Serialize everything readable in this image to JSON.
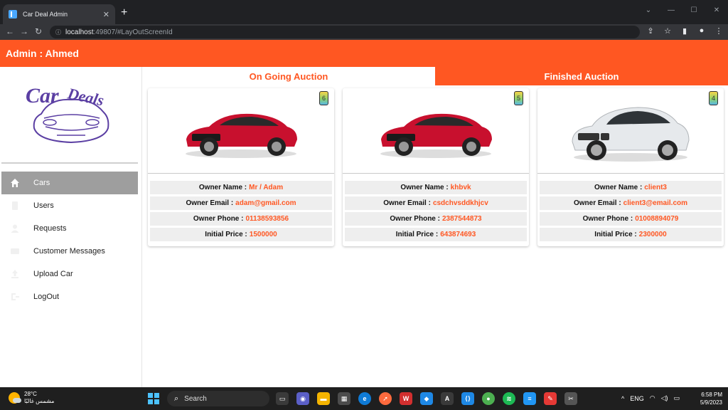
{
  "browser": {
    "tab_title": "Car Deal Admin",
    "url_host": "localhost",
    "url_rest": ":49807/#LayOutScreenId"
  },
  "app": {
    "title": "Admin : Ahmed",
    "logo_text": "CarDeals",
    "accent_color": "#ff5722"
  },
  "sidebar": {
    "items": [
      {
        "label": "Cars",
        "icon": "home-icon",
        "active": true
      },
      {
        "label": "Users",
        "icon": "user-list-icon",
        "active": false
      },
      {
        "label": "Requests",
        "icon": "person-icon",
        "active": false
      },
      {
        "label": "Customer Messages",
        "icon": "message-icon",
        "active": false
      },
      {
        "label": "Upload Car",
        "icon": "upload-icon",
        "active": false
      },
      {
        "label": "LogOut",
        "icon": "logout-icon",
        "active": false
      }
    ]
  },
  "tabs": [
    {
      "label": "On Going Auction",
      "selected": true
    },
    {
      "label": "Finished Auction",
      "selected": false
    }
  ],
  "cars": [
    {
      "badge": "6",
      "car_color": "#c8102e",
      "labels": {
        "name": "Owner Name :",
        "email": "Owner Email :",
        "phone": "Owner Phone :",
        "price": "Initial Price :"
      },
      "owner_name": "Mr / Adam",
      "owner_email": "adam@gmail.com",
      "owner_phone": "01138593856",
      "initial_price": "1500000"
    },
    {
      "badge": "5",
      "car_color": "#c8102e",
      "labels": {
        "name": "Owner Name :",
        "email": "Owner Email :",
        "phone": "Owner Phone :",
        "price": "Initial Price :"
      },
      "owner_name": "khbvk",
      "owner_email": "csdchvsddkhjcv",
      "owner_phone": "2387544873",
      "initial_price": "643874693"
    },
    {
      "badge": "4",
      "car_color": "#e6e9ec",
      "labels": {
        "name": "Owner Name :",
        "email": "Owner Email :",
        "phone": "Owner Phone :",
        "price": "Initial Price :"
      },
      "owner_name": "client3",
      "owner_email": "client3@email.com",
      "owner_phone": "01008894079",
      "initial_price": "2300000"
    }
  ],
  "taskbar": {
    "temperature": "28°C",
    "weather_desc": "مشمس غالبًا",
    "search_label": "Search",
    "language": "ENG",
    "time": "6:58 PM",
    "date": "5/9/2023"
  }
}
